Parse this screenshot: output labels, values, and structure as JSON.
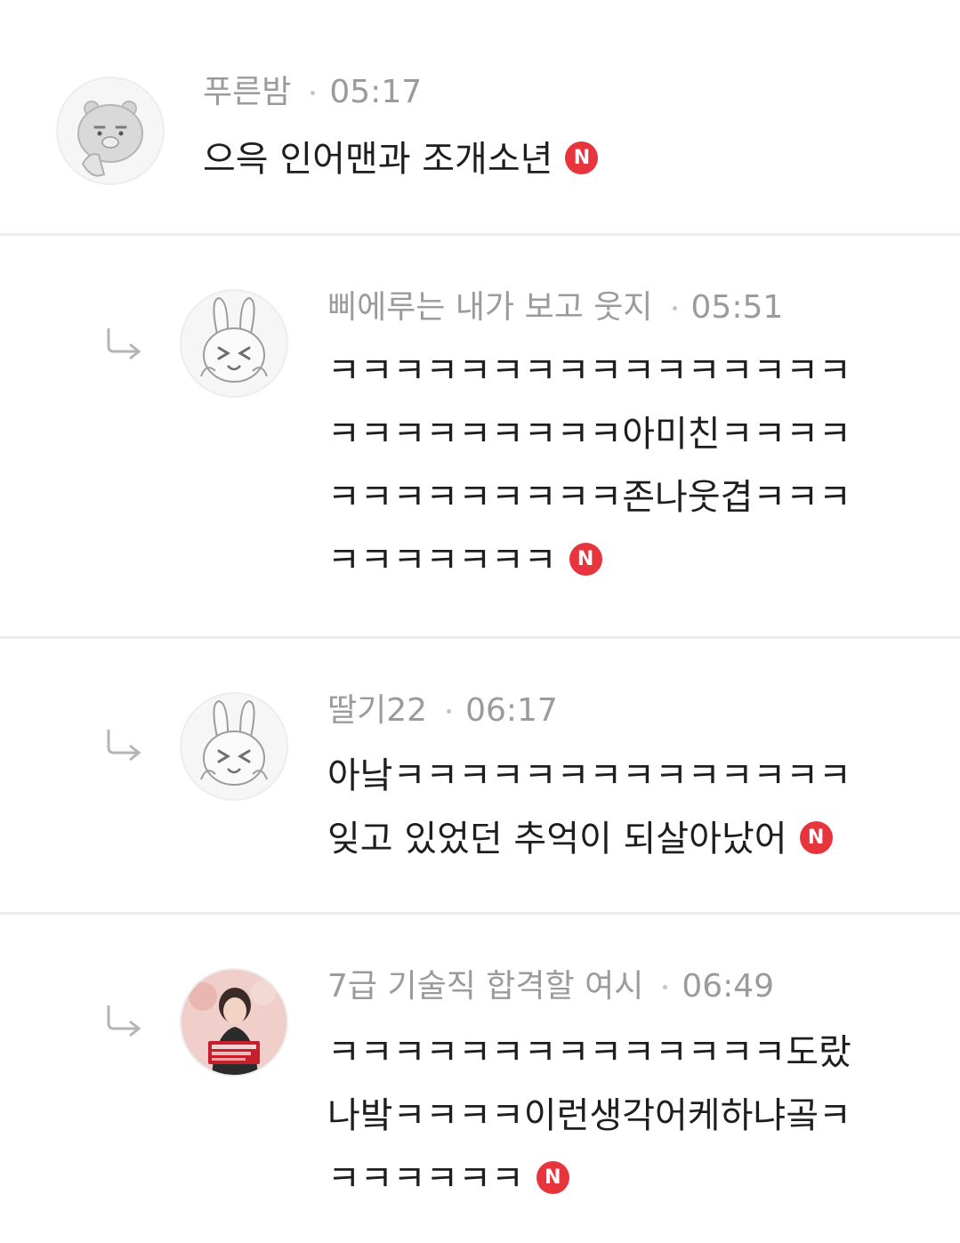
{
  "comments": [
    {
      "author": "푸른밤",
      "time": "05:17",
      "lines": [
        "으윽 인어맨과 조개소년"
      ],
      "badge": "N",
      "avatar": "ryan-character-avatar",
      "is_reply": false
    },
    {
      "author": "삐에루는 내가 보고 웃지",
      "time": "05:51",
      "lines": [
        "ㅋㅋㅋㅋㅋㅋㅋㅋㅋㅋㅋㅋㅋㅋㅋㅋ",
        "ㅋㅋㅋㅋㅋㅋㅋㅋㅋ아미친ㅋㅋㅋㅋ",
        "ㅋㅋㅋㅋㅋㅋㅋㅋㅋ존나웃겹ㅋㅋㅋ",
        "ㅋㅋㅋㅋㅋㅋㅋ"
      ],
      "badge": "N",
      "avatar": "bunny-character-avatar",
      "is_reply": true
    },
    {
      "author": "딸기22",
      "time": "06:17",
      "lines": [
        "아낰ㅋㅋㅋㅋㅋㅋㅋㅋㅋㅋㅋㅋㅋㅋ",
        "잊고 있었던 추억이 되살아났어"
      ],
      "badge": "N",
      "avatar": "bunny-character-avatar",
      "is_reply": true
    },
    {
      "author": "7급 기술직 합격할 여시",
      "time": "06:49",
      "lines": [
        "ㅋㅋㅋㅋㅋㅋㅋㅋㅋㅋㅋㅋㅋㅋ도랐",
        "나밬ㅋㅋㅋㅋ이런생각어케하냐곸ㅋ",
        "ㅋㅋㅋㅋㅋㅋ"
      ],
      "badge": "N",
      "avatar": "photo-avatar",
      "is_reply": true
    }
  ],
  "colors": {
    "badge": "#e8343c",
    "meta_text": "#9b9b9b",
    "body_text": "#1e1e1e",
    "divider": "#ededed"
  }
}
